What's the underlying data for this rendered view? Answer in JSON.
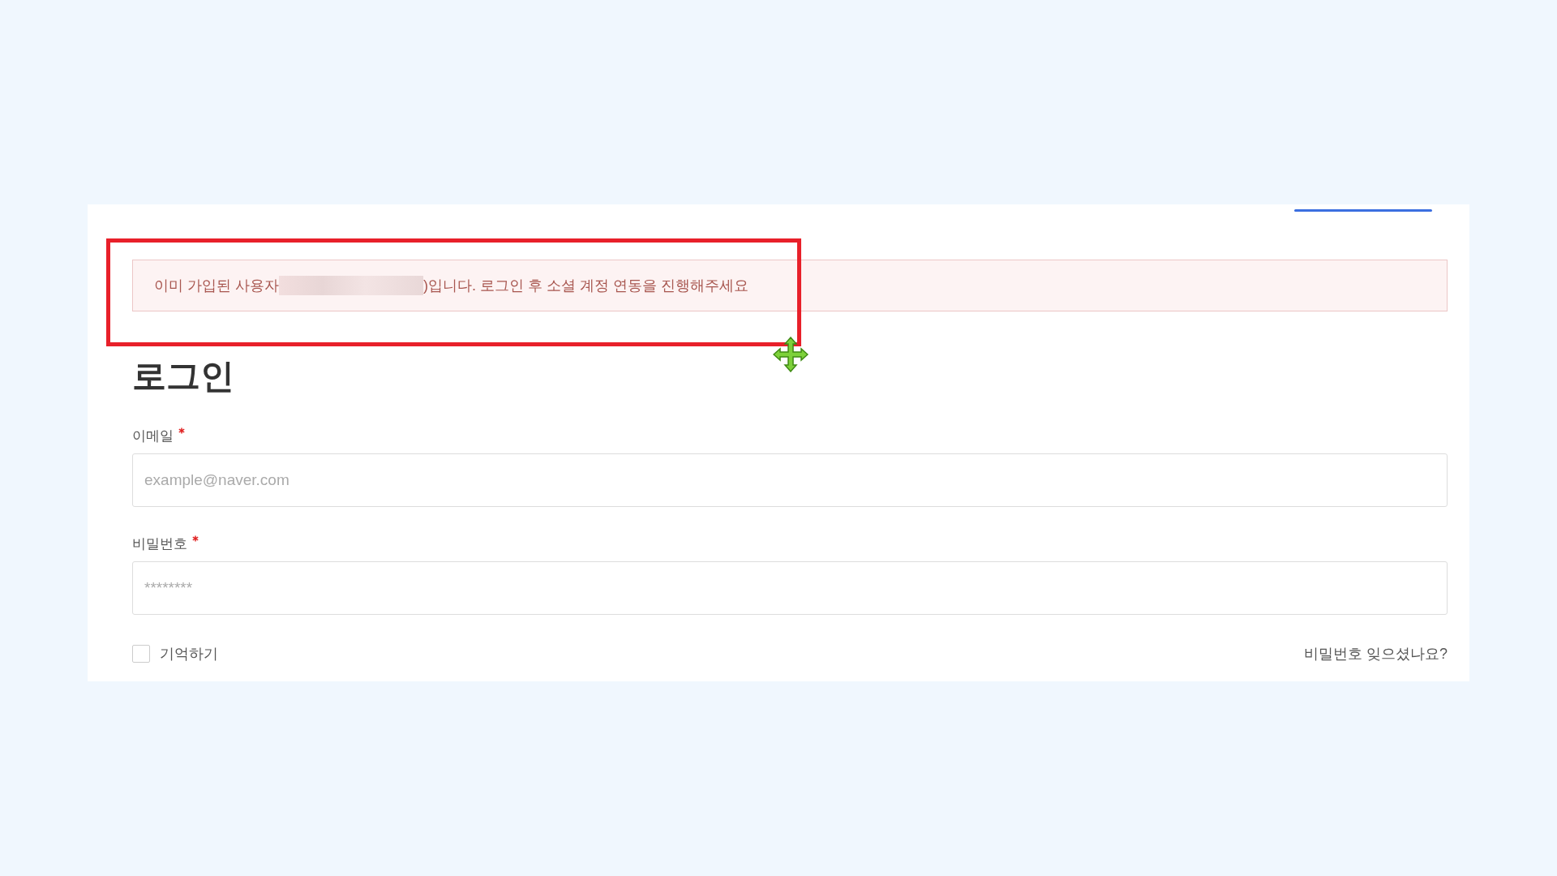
{
  "alert": {
    "text_before": "이미 가입된 사용자",
    "text_after": ")입니다. 로그인 후 소셜 계정 연동을 진행해주세요",
    "redacted": true
  },
  "title": "로그인",
  "fields": [
    {
      "label": "이메일",
      "required": true,
      "placeholder": "example@naver.com"
    },
    {
      "label": "비밀번호",
      "required": true,
      "placeholder": "********"
    }
  ],
  "remember": {
    "label": "기억하기",
    "checked": false
  },
  "forgot_link": "비밀번호 잊으셨나요?"
}
